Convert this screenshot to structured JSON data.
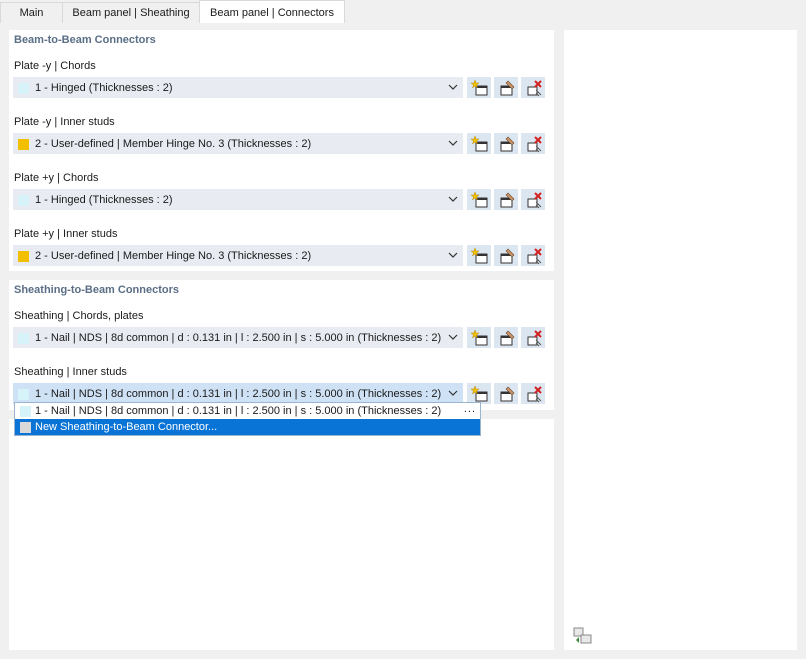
{
  "tabs": [
    {
      "label": "Main"
    },
    {
      "label": "Beam panel | Sheathing"
    },
    {
      "label": "Beam panel | Connectors"
    }
  ],
  "beam_section": {
    "title": "Beam-to-Beam Connectors",
    "fields": [
      {
        "label": "Plate -y | Chords",
        "value": "1 - Hinged (Thicknesses : 2)",
        "swatch": "#d5f3f8"
      },
      {
        "label": "Plate -y | Inner studs",
        "value": "2 - User-defined | Member Hinge No. 3 (Thicknesses : 2)",
        "swatch": "#f2c000"
      },
      {
        "label": "Plate +y | Chords",
        "value": "1 - Hinged (Thicknesses : 2)",
        "swatch": "#d5f3f8"
      },
      {
        "label": "Plate +y | Inner studs",
        "value": "2 - User-defined | Member Hinge No. 3 (Thicknesses : 2)",
        "swatch": "#f2c000"
      }
    ]
  },
  "sheathing_section": {
    "title": "Sheathing-to-Beam Connectors",
    "fields": [
      {
        "label": "Sheathing | Chords, plates",
        "value": "1 - Nail | NDS | 8d common | d : 0.131 in | l : 2.500 in | s : 5.000 in (Thicknesses : 2)",
        "swatch": "#d5f3f8"
      },
      {
        "label": "Sheathing | Inner studs",
        "value": "1 - Nail | NDS | 8d common | d : 0.131 in | l : 2.500 in | s : 5.000 in (Thicknesses : 2)",
        "swatch": "#d5f3f8"
      }
    ]
  },
  "dropdown": {
    "items": [
      {
        "label": "1 - Nail | NDS | 8d common | d : 0.131 in | l : 2.500 in | s : 5.000 in (Thicknesses : 2)",
        "swatch": "#d5f3f8",
        "more": "..."
      },
      {
        "label": "New Sheathing-to-Beam Connector...",
        "swatch": "#d9d9d9"
      }
    ]
  },
  "icons": {
    "new": "new-item-icon",
    "edit": "edit-item-icon",
    "delete": "delete-item-icon",
    "chevron": "chevron-down-icon",
    "corner": "copy-settings-icon"
  }
}
